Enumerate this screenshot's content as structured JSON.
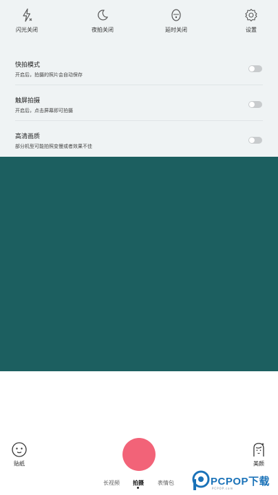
{
  "quick_settings": [
    {
      "icon": "flash-off-icon",
      "label": "闪光关闭"
    },
    {
      "icon": "night-mode-icon",
      "label": "夜拍关闭"
    },
    {
      "icon": "timer-icon",
      "label": "延时关闭"
    },
    {
      "icon": "gear-icon",
      "label": "设置"
    }
  ],
  "options": [
    {
      "title": "快拍模式",
      "description": "开启后，拍摄的照片会自动保存",
      "enabled": false
    },
    {
      "title": "触屏拍摄",
      "description": "开启后，点击屏幕即可拍摄",
      "enabled": false
    },
    {
      "title": "高清画质",
      "description": "部分机型可能拍照变慢或者效果不佳",
      "enabled": false
    }
  ],
  "preview": {
    "color": "#1c5f60"
  },
  "bottom": {
    "sticker_label": "贴纸",
    "beauty_label": "美颜",
    "shutter_color": "#f26378",
    "modes": [
      "长视频",
      "拍摄",
      "表情包"
    ],
    "active_mode": "拍摄"
  },
  "watermark": {
    "text": "PCPOP下载",
    "subtext": "PCPOP.com"
  },
  "colors": {
    "accent": "#f26378",
    "panel": "#eff3f4",
    "watermark": "#1a72b8"
  }
}
